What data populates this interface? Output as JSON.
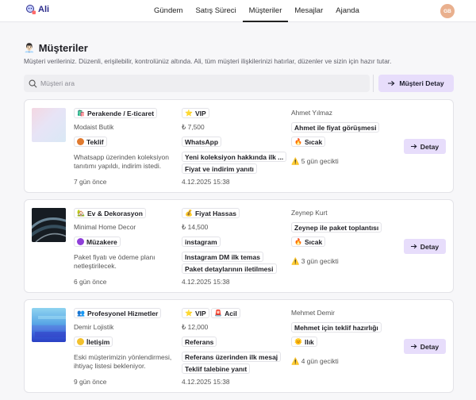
{
  "app": {
    "name": "Ali",
    "avatar_initials": "GB"
  },
  "nav": [
    {
      "label": "Gündem",
      "active": false
    },
    {
      "label": "Satış Süreci",
      "active": false
    },
    {
      "label": "Müşteriler",
      "active": true
    },
    {
      "label": "Mesajlar",
      "active": false
    },
    {
      "label": "Ajanda",
      "active": false
    }
  ],
  "page": {
    "title": "Müşteriler",
    "description": "Müşteri verileriniz. Düzenli, erişilebilir, kontrolünüz altında. Ali, tüm müşteri ilişkilerinizi hatırlar, düzenler ve sizin için hazır tutar."
  },
  "search": {
    "placeholder": "Müşteri ara"
  },
  "detail_button_top": "Müşteri Detay",
  "customers": [
    {
      "category": "Perakende / E-ticaret",
      "company": "Modaist Butik",
      "stage": "Teklif",
      "stage_color": "#e07a2f",
      "note": "Whatsapp üzerinden koleksiyon tanıtımı yapıldı, indirim istedi.",
      "created": "7 gün önce",
      "segment_tags": [
        "VIP"
      ],
      "amount": "₺ 7,500",
      "channel": "WhatsApp",
      "last_topic": "Yeni koleksiyon hakkında ilk ...",
      "next_topic": "Fiyat ve indirim yanıtı",
      "date": "4.12.2025 15:38",
      "contact": "Ahmet Yılmaz",
      "next_action": "Ahmet ile fiyat görüşmesi",
      "temperature": "Sıcak",
      "delay": "5 gün gecikti",
      "detail_label": "Detay"
    },
    {
      "category": "Ev & Dekorasyon",
      "company": "Minimal Home Decor",
      "stage": "Müzakere",
      "stage_color": "#8f3fd9",
      "note": "Paket fiyatı ve ödeme planı netleştirilecek.",
      "created": "6 gün önce",
      "segment_tags": [
        "Fiyat Hassas"
      ],
      "amount": "₺ 14,500",
      "channel": "instagram",
      "last_topic": "Instagram DM ilk temas",
      "next_topic": "Paket detaylarının iletilmesi",
      "date": "4.12.2025 15:38",
      "contact": "Zeynep Kurt",
      "next_action": "Zeynep ile paket toplantısı",
      "temperature": "Sıcak",
      "delay": "3 gün gecikti",
      "detail_label": "Detay"
    },
    {
      "category": "Profesyonel Hizmetler",
      "company": "Demir Lojistik",
      "stage": "İletişim",
      "stage_color": "#f2c12e",
      "note": "Eski müşterimizin yönlendirmesi, ihtiyaç listesi bekleniyor.",
      "created": "9 gün önce",
      "segment_tags": [
        "VIP",
        "Acil"
      ],
      "amount": "₺ 12,000",
      "channel": "Referans",
      "last_topic": "Referans üzerinden ilk mesaj",
      "next_topic": "Teklif talebine yanıt",
      "date": "4.12.2025 15:38",
      "contact": "Mehmet Demir",
      "next_action": "Mehmet için teklif hazırlığı",
      "temperature": "Ilık",
      "delay": "4 gün gecikti",
      "detail_label": "Detay"
    }
  ]
}
